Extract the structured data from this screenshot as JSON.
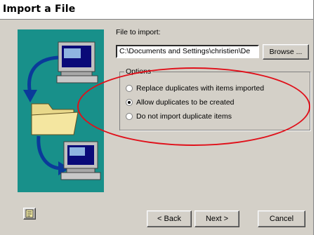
{
  "dialog": {
    "title": "Import a File"
  },
  "file": {
    "label": "File to import:",
    "value": "C:\\Documents and Settings\\christien\\De",
    "browse_label": "Browse ..."
  },
  "options": {
    "legend": "Options",
    "items": [
      {
        "label": "Replace duplicates with items imported",
        "checked": false
      },
      {
        "label": "Allow duplicates to be created",
        "checked": true
      },
      {
        "label": "Do not import duplicate items",
        "checked": false
      }
    ]
  },
  "buttons": {
    "back": "< Back",
    "next": "Next >",
    "cancel": "Cancel"
  },
  "colors": {
    "panel": "#18908a",
    "annotation": "#e0101a"
  }
}
